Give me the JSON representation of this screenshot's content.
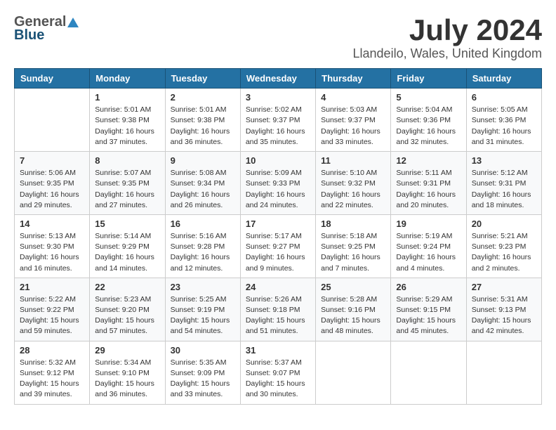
{
  "logo": {
    "general": "General",
    "blue": "Blue"
  },
  "title": {
    "month_year": "July 2024",
    "location": "Llandeilo, Wales, United Kingdom"
  },
  "calendar": {
    "headers": [
      "Sunday",
      "Monday",
      "Tuesday",
      "Wednesday",
      "Thursday",
      "Friday",
      "Saturday"
    ],
    "weeks": [
      [
        {
          "day": "",
          "info": ""
        },
        {
          "day": "1",
          "info": "Sunrise: 5:01 AM\nSunset: 9:38 PM\nDaylight: 16 hours\nand 37 minutes."
        },
        {
          "day": "2",
          "info": "Sunrise: 5:01 AM\nSunset: 9:38 PM\nDaylight: 16 hours\nand 36 minutes."
        },
        {
          "day": "3",
          "info": "Sunrise: 5:02 AM\nSunset: 9:37 PM\nDaylight: 16 hours\nand 35 minutes."
        },
        {
          "day": "4",
          "info": "Sunrise: 5:03 AM\nSunset: 9:37 PM\nDaylight: 16 hours\nand 33 minutes."
        },
        {
          "day": "5",
          "info": "Sunrise: 5:04 AM\nSunset: 9:36 PM\nDaylight: 16 hours\nand 32 minutes."
        },
        {
          "day": "6",
          "info": "Sunrise: 5:05 AM\nSunset: 9:36 PM\nDaylight: 16 hours\nand 31 minutes."
        }
      ],
      [
        {
          "day": "7",
          "info": "Sunrise: 5:06 AM\nSunset: 9:35 PM\nDaylight: 16 hours\nand 29 minutes."
        },
        {
          "day": "8",
          "info": "Sunrise: 5:07 AM\nSunset: 9:35 PM\nDaylight: 16 hours\nand 27 minutes."
        },
        {
          "day": "9",
          "info": "Sunrise: 5:08 AM\nSunset: 9:34 PM\nDaylight: 16 hours\nand 26 minutes."
        },
        {
          "day": "10",
          "info": "Sunrise: 5:09 AM\nSunset: 9:33 PM\nDaylight: 16 hours\nand 24 minutes."
        },
        {
          "day": "11",
          "info": "Sunrise: 5:10 AM\nSunset: 9:32 PM\nDaylight: 16 hours\nand 22 minutes."
        },
        {
          "day": "12",
          "info": "Sunrise: 5:11 AM\nSunset: 9:31 PM\nDaylight: 16 hours\nand 20 minutes."
        },
        {
          "day": "13",
          "info": "Sunrise: 5:12 AM\nSunset: 9:31 PM\nDaylight: 16 hours\nand 18 minutes."
        }
      ],
      [
        {
          "day": "14",
          "info": "Sunrise: 5:13 AM\nSunset: 9:30 PM\nDaylight: 16 hours\nand 16 minutes."
        },
        {
          "day": "15",
          "info": "Sunrise: 5:14 AM\nSunset: 9:29 PM\nDaylight: 16 hours\nand 14 minutes."
        },
        {
          "day": "16",
          "info": "Sunrise: 5:16 AM\nSunset: 9:28 PM\nDaylight: 16 hours\nand 12 minutes."
        },
        {
          "day": "17",
          "info": "Sunrise: 5:17 AM\nSunset: 9:27 PM\nDaylight: 16 hours\nand 9 minutes."
        },
        {
          "day": "18",
          "info": "Sunrise: 5:18 AM\nSunset: 9:25 PM\nDaylight: 16 hours\nand 7 minutes."
        },
        {
          "day": "19",
          "info": "Sunrise: 5:19 AM\nSunset: 9:24 PM\nDaylight: 16 hours\nand 4 minutes."
        },
        {
          "day": "20",
          "info": "Sunrise: 5:21 AM\nSunset: 9:23 PM\nDaylight: 16 hours\nand 2 minutes."
        }
      ],
      [
        {
          "day": "21",
          "info": "Sunrise: 5:22 AM\nSunset: 9:22 PM\nDaylight: 15 hours\nand 59 minutes."
        },
        {
          "day": "22",
          "info": "Sunrise: 5:23 AM\nSunset: 9:20 PM\nDaylight: 15 hours\nand 57 minutes."
        },
        {
          "day": "23",
          "info": "Sunrise: 5:25 AM\nSunset: 9:19 PM\nDaylight: 15 hours\nand 54 minutes."
        },
        {
          "day": "24",
          "info": "Sunrise: 5:26 AM\nSunset: 9:18 PM\nDaylight: 15 hours\nand 51 minutes."
        },
        {
          "day": "25",
          "info": "Sunrise: 5:28 AM\nSunset: 9:16 PM\nDaylight: 15 hours\nand 48 minutes."
        },
        {
          "day": "26",
          "info": "Sunrise: 5:29 AM\nSunset: 9:15 PM\nDaylight: 15 hours\nand 45 minutes."
        },
        {
          "day": "27",
          "info": "Sunrise: 5:31 AM\nSunset: 9:13 PM\nDaylight: 15 hours\nand 42 minutes."
        }
      ],
      [
        {
          "day": "28",
          "info": "Sunrise: 5:32 AM\nSunset: 9:12 PM\nDaylight: 15 hours\nand 39 minutes."
        },
        {
          "day": "29",
          "info": "Sunrise: 5:34 AM\nSunset: 9:10 PM\nDaylight: 15 hours\nand 36 minutes."
        },
        {
          "day": "30",
          "info": "Sunrise: 5:35 AM\nSunset: 9:09 PM\nDaylight: 15 hours\nand 33 minutes."
        },
        {
          "day": "31",
          "info": "Sunrise: 5:37 AM\nSunset: 9:07 PM\nDaylight: 15 hours\nand 30 minutes."
        },
        {
          "day": "",
          "info": ""
        },
        {
          "day": "",
          "info": ""
        },
        {
          "day": "",
          "info": ""
        }
      ]
    ]
  }
}
